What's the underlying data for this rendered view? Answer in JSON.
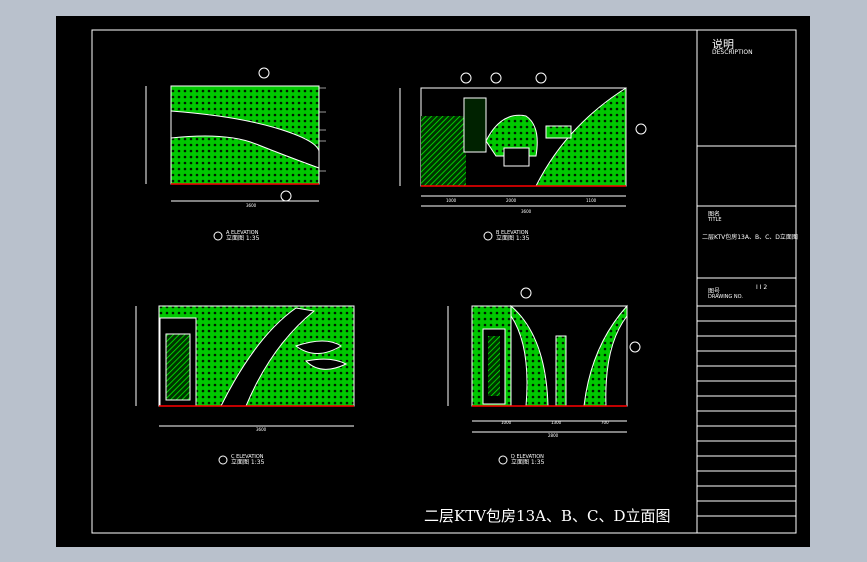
{
  "title_block": {
    "heading": "说明",
    "heading_en": "DESCRIPTION",
    "title_label_cn": "图名",
    "title_label_en": "TITLE",
    "title_value": "二层KTV包房13A、B、C、D立面图",
    "number_label_cn": "图号",
    "number_label_en": "DRAWING NO.",
    "number_value": "I I 2"
  },
  "drawing_title": "二层KTV包房13A、B、C、D立面图",
  "elevations": [
    {
      "tag": "A",
      "caption_en": "ELEVATION",
      "caption_cn": "立面图 1:35",
      "width_dim": "3600"
    },
    {
      "tag": "B",
      "caption_en": "ELEVATION",
      "caption_cn": "立面图 1:35",
      "width_dim": "3600",
      "sub_dims": [
        "1000",
        "2000",
        "1100"
      ]
    },
    {
      "tag": "C",
      "caption_en": "ELEVATION",
      "caption_cn": "立面图 1:35",
      "width_dim": "3600"
    },
    {
      "tag": "D",
      "caption_en": "ELEVATION",
      "caption_cn": "立面图 1:35",
      "width_dim": "2800",
      "sub_dims": [
        "1000",
        "1300",
        "700"
      ]
    }
  ],
  "colors": {
    "canvas": "#000000",
    "window_bg": "#bcc4cf",
    "fill": "#00ff00",
    "line": "#ffffff",
    "dim": "#ff0000",
    "accent": "#00ffff"
  }
}
